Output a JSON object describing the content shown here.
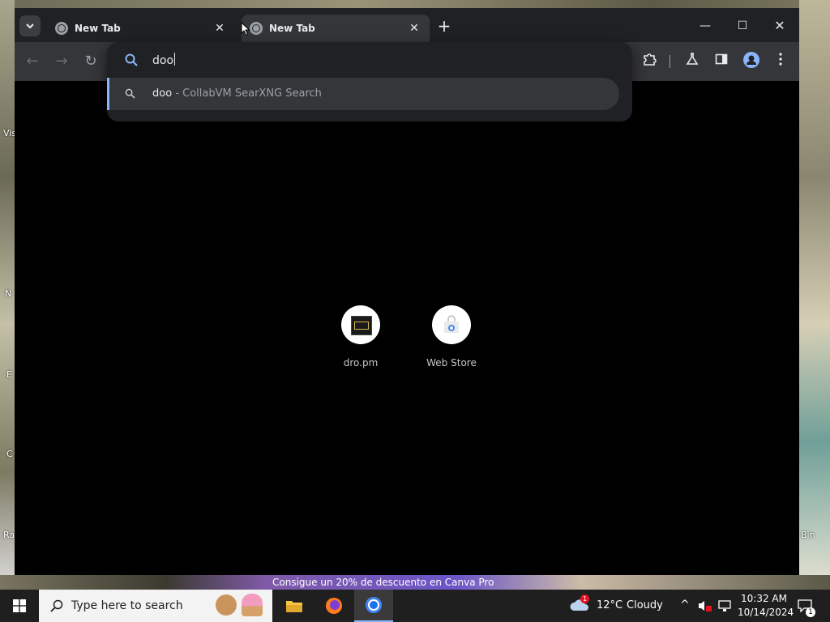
{
  "desktop": {
    "labels": [
      "Vis",
      "N",
      "E",
      "C",
      "Ra",
      "Bin"
    ],
    "ad_text": "Consigue un 20% de descuento en Canva Pro"
  },
  "browser": {
    "tabs": [
      {
        "title": "New Tab"
      },
      {
        "title": "New Tab"
      }
    ],
    "omnibox": {
      "query": "doo",
      "suggestion": {
        "query": "doo",
        "provider": "- CollabVM SearXNG Search"
      }
    },
    "shortcuts": [
      {
        "label": "dro.pm",
        "icon": "dropm-icon"
      },
      {
        "label": "Web Store",
        "icon": "web-store-icon"
      }
    ],
    "colors": {
      "accent": "#8ab4f8",
      "tabstrip": "#202124",
      "toolbar": "#35363a"
    }
  },
  "taskbar": {
    "search_placeholder": "Type here to search",
    "weather": {
      "temp": "12°C",
      "condition": "Cloudy",
      "badge": "1"
    },
    "clock": {
      "time": "10:32 AM",
      "date": "10/14/2024"
    },
    "notifications": "1"
  }
}
